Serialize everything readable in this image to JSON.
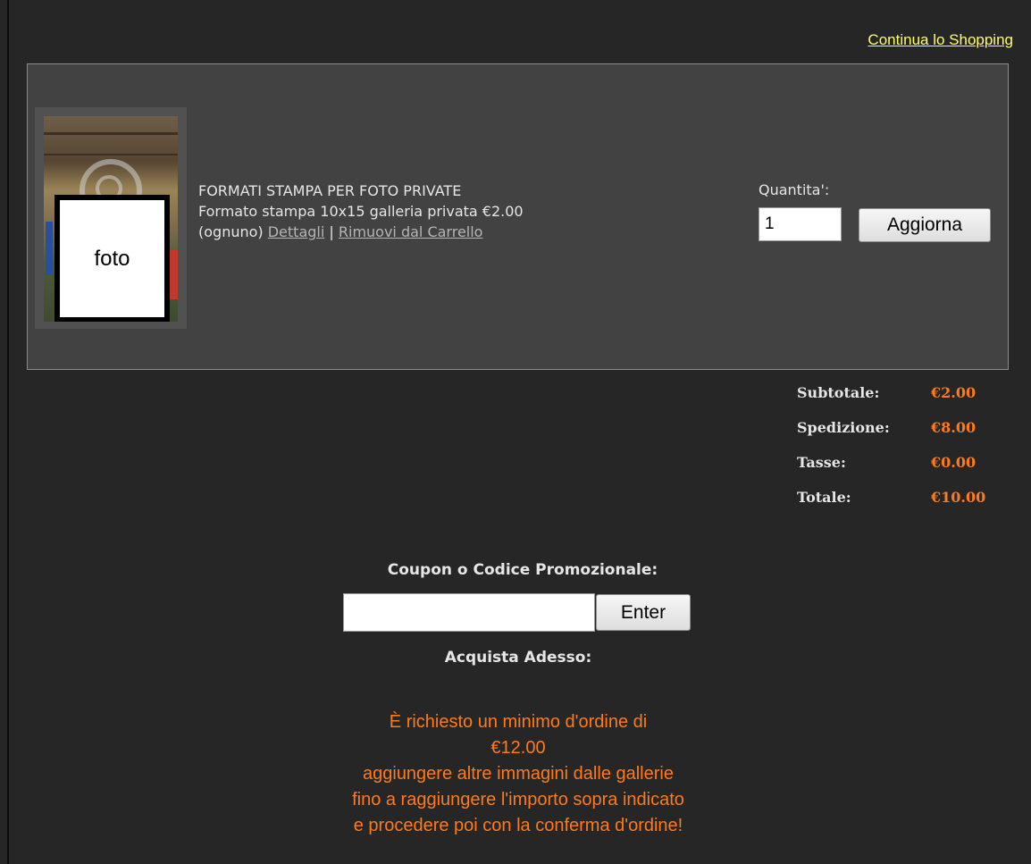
{
  "header": {
    "continue_link": "Continua lo Shopping"
  },
  "cart": {
    "item": {
      "image_label": "foto",
      "title": "FORMATI STAMPA PER FOTO PRIVATE",
      "description": "Formato stampa 10x15 galleria privata €2.00",
      "price_note": "(ognuno)",
      "details_link": "Dettagli",
      "separator": "|",
      "remove_link": "Rimuovi dal Carrello"
    },
    "quantity_label": "Quantita':",
    "quantity_value": "1",
    "update_button": "Aggiorna"
  },
  "totals": {
    "subtotal_label": "Subtotale:",
    "subtotal_value": "€2.00",
    "shipping_label": "Spedizione:",
    "shipping_value": "€8.00",
    "tax_label": "Tasse:",
    "tax_value": "€0.00",
    "total_label": "Totale:",
    "total_value": "€10.00"
  },
  "coupon": {
    "label": "Coupon o Codice Promozionale:",
    "value": "",
    "enter_button": "Enter"
  },
  "checkout": {
    "label": "Acquista Adesso:",
    "message_lines": [
      "È richiesto un minimo d'ordine di",
      "€12.00",
      "aggiungere altre immagini dalle gallerie",
      "fino a raggiungere l'importo sopra indicato",
      "e procedere poi con la conferma d'ordine!"
    ]
  },
  "colors": {
    "background": "#262626",
    "panel": "#424242",
    "link_yellow": "#ffff66",
    "accent_orange": "#ff7a1a"
  }
}
